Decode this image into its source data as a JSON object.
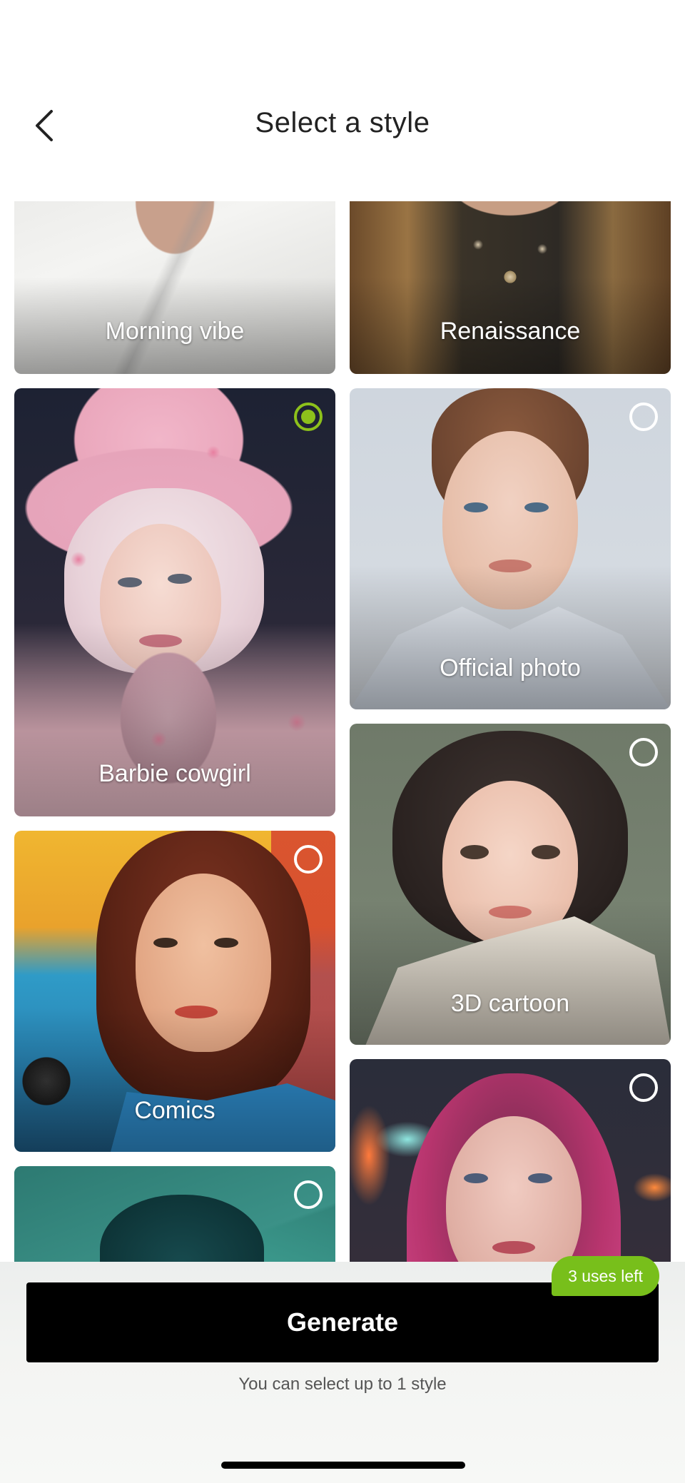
{
  "header": {
    "title": "Select a style",
    "back_icon": "chevron-left-icon"
  },
  "styles": [
    {
      "label": "Morning vibe",
      "selected": false
    },
    {
      "label": "Renaissance",
      "selected": false
    },
    {
      "label": "Barbie cowgirl",
      "selected": true
    },
    {
      "label": "Official photo",
      "selected": false
    },
    {
      "label": "3D cartoon",
      "selected": false
    },
    {
      "label": "Comics",
      "selected": false
    },
    {
      "label": "",
      "selected": false
    },
    {
      "label": "",
      "selected": false
    }
  ],
  "footer": {
    "generate_label": "Generate",
    "uses_badge": "3 uses left",
    "hint": "You can select up to 1 style"
  },
  "colors": {
    "accent_green": "#8dc11b",
    "badge_green": "#78bf1b",
    "button_black": "#000000"
  }
}
